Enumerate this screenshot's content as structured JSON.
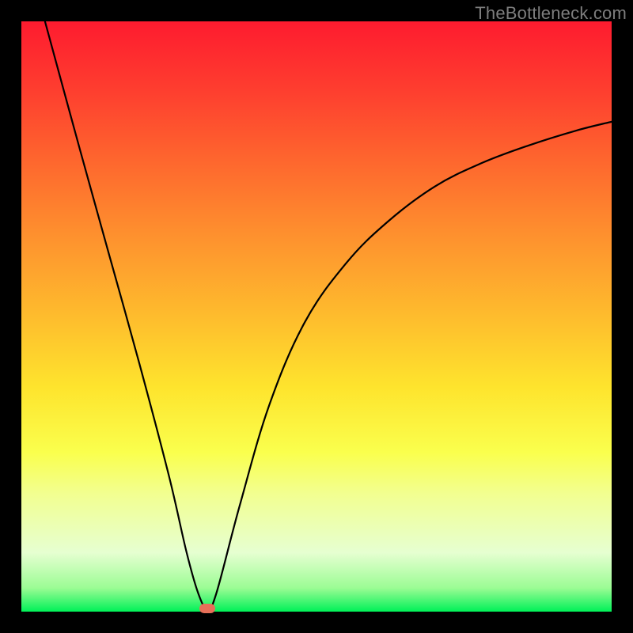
{
  "attribution": "TheBottleneck.com",
  "chart_data": {
    "type": "line",
    "title": "",
    "xlabel": "",
    "ylabel": "",
    "xlim": [
      0,
      100
    ],
    "ylim": [
      0,
      100
    ],
    "series": [
      {
        "name": "bottleneck-curve",
        "x": [
          4,
          10,
          15,
          20,
          25,
          28,
          30,
          31.5,
          33,
          37,
          42,
          48,
          55,
          62,
          70,
          78,
          86,
          94,
          100
        ],
        "y": [
          100,
          78,
          60,
          42,
          23,
          10,
          3,
          0.5,
          3,
          18,
          35,
          49,
          59,
          66,
          72,
          76,
          79,
          81.5,
          83
        ]
      }
    ],
    "marker": {
      "x": 31.5,
      "y": 0.6,
      "name": "optimum-point",
      "color": "#e76f59"
    },
    "background_gradient": {
      "top": "#fe1b2f",
      "bottom": "#00f158"
    }
  }
}
